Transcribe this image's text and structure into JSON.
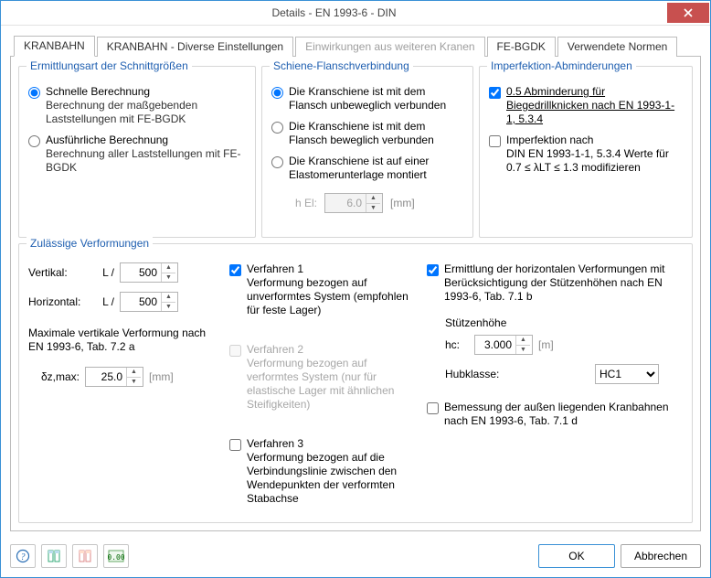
{
  "window": {
    "title": "Details - EN 1993-6 - DIN"
  },
  "tabs": [
    {
      "label": "KRANBAHN"
    },
    {
      "label": "KRANBAHN - Diverse Einstellungen"
    },
    {
      "label": "Einwirkungen aus weiteren Kranen"
    },
    {
      "label": "FE-BGDK"
    },
    {
      "label": "Verwendete Normen"
    }
  ],
  "group1": {
    "title": "Ermittlungsart der Schnittgrößen",
    "opt1": {
      "label": "Schnelle Berechnung",
      "sub": "Berechnung der maßgebenden Laststellungen mit FE-BGDK"
    },
    "opt2": {
      "label": "Ausführliche Berechnung",
      "sub": "Berechnung aller Laststellungen mit FE-BGDK"
    }
  },
  "group2": {
    "title": "Schiene-Flanschverbindung",
    "opt1": "Die Kranschiene ist mit dem Flansch unbeweglich verbunden",
    "opt2": "Die Kranschiene ist mit dem Flansch beweglich verbunden",
    "opt3": "Die Kranschiene ist auf einer Elastomerunterlage montiert",
    "hEl_label": "h El:",
    "hEl_value": "6.0",
    "hEl_unit": "[mm]"
  },
  "group3": {
    "title": "Imperfektion-Abminderungen",
    "chk1": "0.5 Abminderung für Biegedrillknicken nach EN 1993-1-1, 5.3.4",
    "chk2": "Imperfektion nach",
    "chk2_sub": "DIN EN 1993-1-1, 5.3.4 Werte für 0.7 ≤ λLT ≤ 1.3 modifizieren"
  },
  "group4": {
    "title": "Zulässige Verformungen",
    "vertikal": "Vertikal:",
    "horizontal": "Horizontal:",
    "Lslash": "L /",
    "v_val": "500",
    "h_val": "500",
    "max_note": "Maximale vertikale Verformung nach EN 1993-6, Tab. 7.2 a",
    "delta_label": "δz,max:",
    "delta_val": "25.0",
    "mm": "[mm]",
    "verf1": {
      "label": "Verfahren 1",
      "sub": "Verformung bezogen auf unverformtes System (empfohlen für feste Lager)"
    },
    "verf2": {
      "label": "Verfahren 2",
      "sub": "Verformung bezogen auf verformtes System (nur für elastische Lager mit ähnlichen Steifigkeiten)"
    },
    "verf3": {
      "label": "Verfahren 3",
      "sub": "Verformung bezogen auf die Verbindungslinie zwischen den Wendepunkten der verformten Stabachse"
    },
    "horiz_chk": "Ermittlung der horizontalen Verformungen mit Berücksichtigung der Stützenhöhen nach EN 1993-6, Tab. 7.1 b",
    "stutz_label": "Stützenhöhe",
    "hc_label": "hc:",
    "hc_val": "3.000",
    "hc_unit": "[m]",
    "hub_label": "Hubklasse:",
    "hub_val": "HC1",
    "bem_chk": "Bemessung der außen liegenden Kranbahnen nach EN 1993-6, Tab. 7.1 d"
  },
  "footer": {
    "ok": "OK",
    "cancel": "Abbrechen"
  }
}
